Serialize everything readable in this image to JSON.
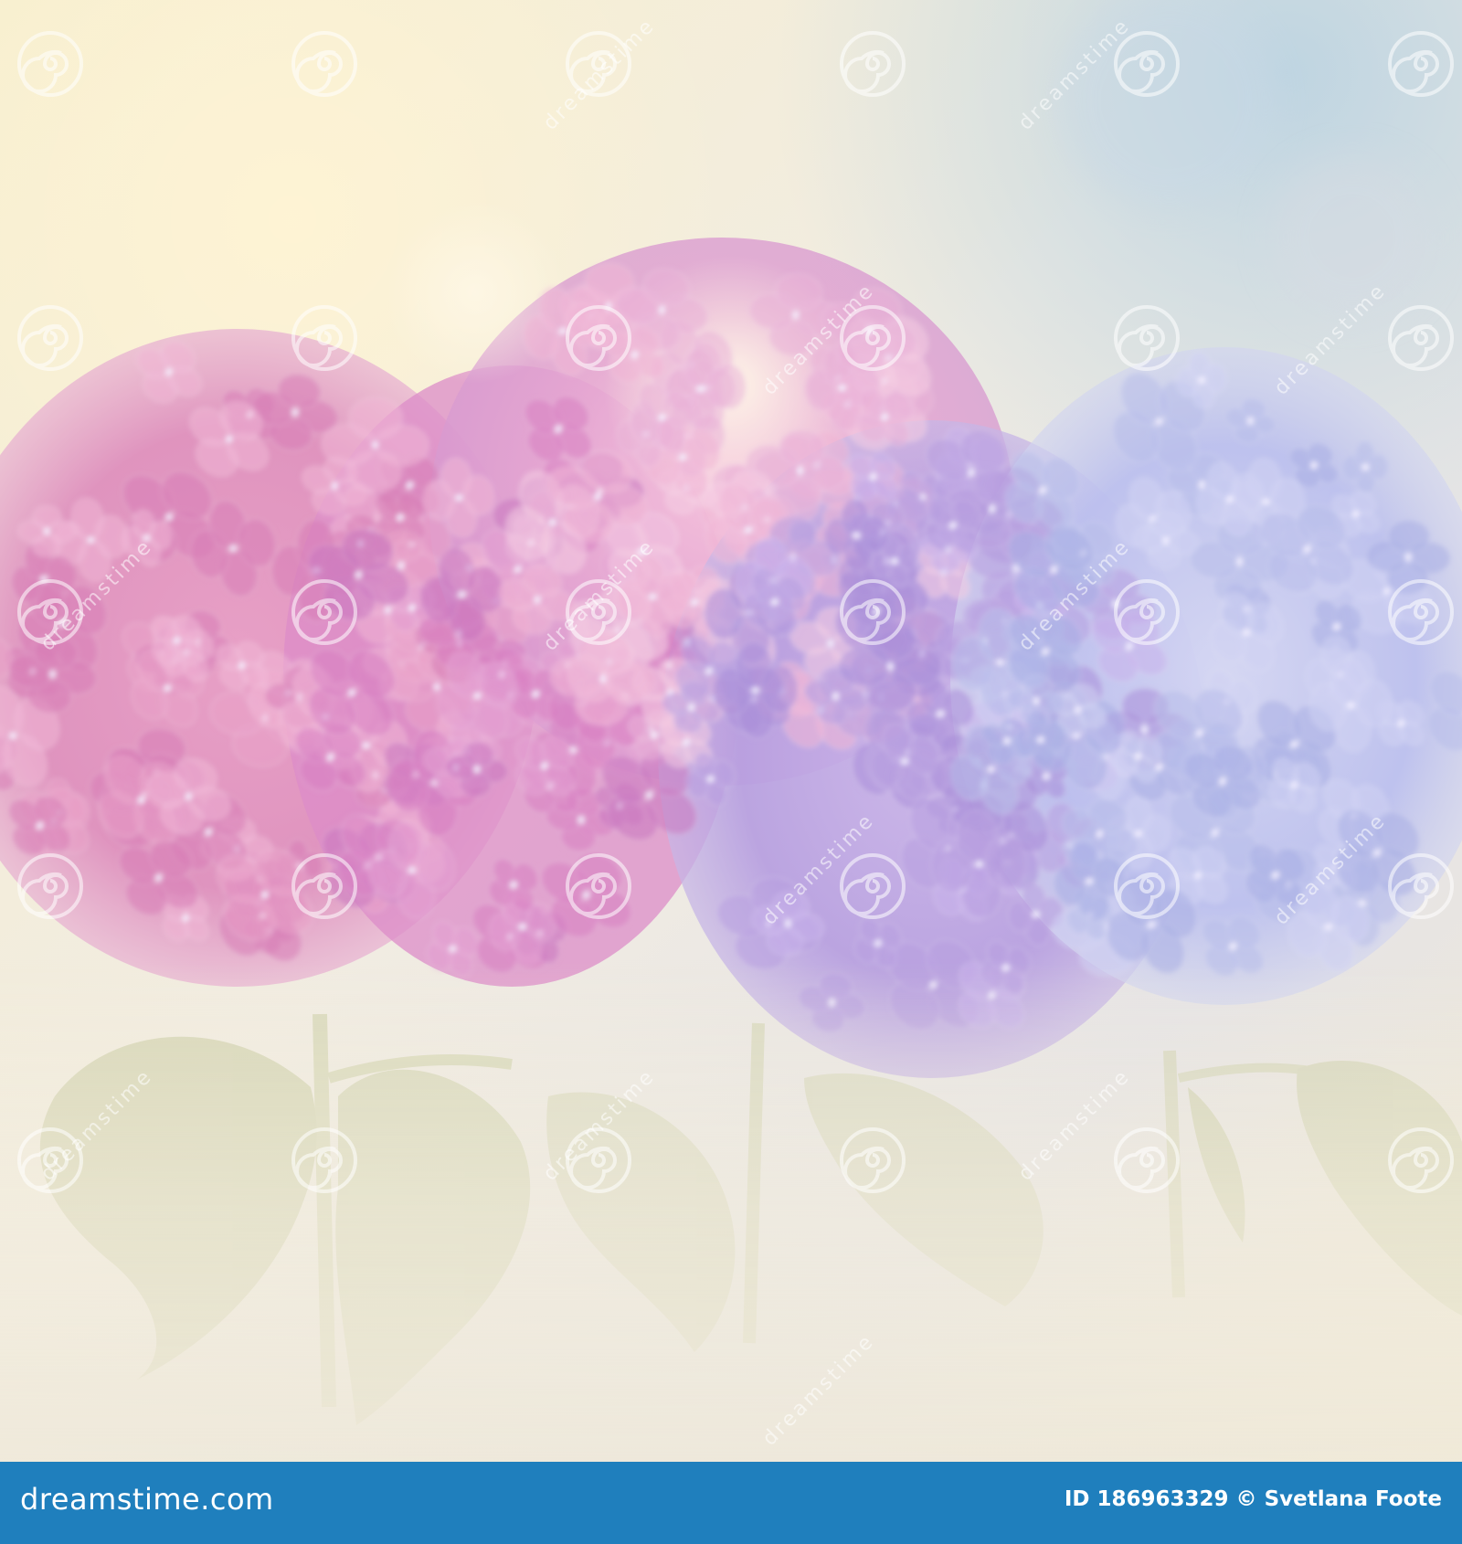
{
  "image": {
    "subject": "hydrangea-flowers-photo",
    "palette": {
      "background_light": "#f6efd8",
      "background_blue": "#cfdde6",
      "pink_deep": "#d77fb6",
      "pink_soft": "#f0b6d6",
      "lilac": "#b9a0e0",
      "periwinkle": "#b8bdea",
      "leaf": "#cfd2ad"
    }
  },
  "watermark": {
    "icon": "spiral-icon",
    "word": "dreamstime"
  },
  "footer": {
    "background": "#1f7fbd",
    "brand": "dreamstime.com",
    "id_label": "ID",
    "id_value": "186963329",
    "copyright_symbol": "©",
    "author": "Svetlana Foote"
  }
}
